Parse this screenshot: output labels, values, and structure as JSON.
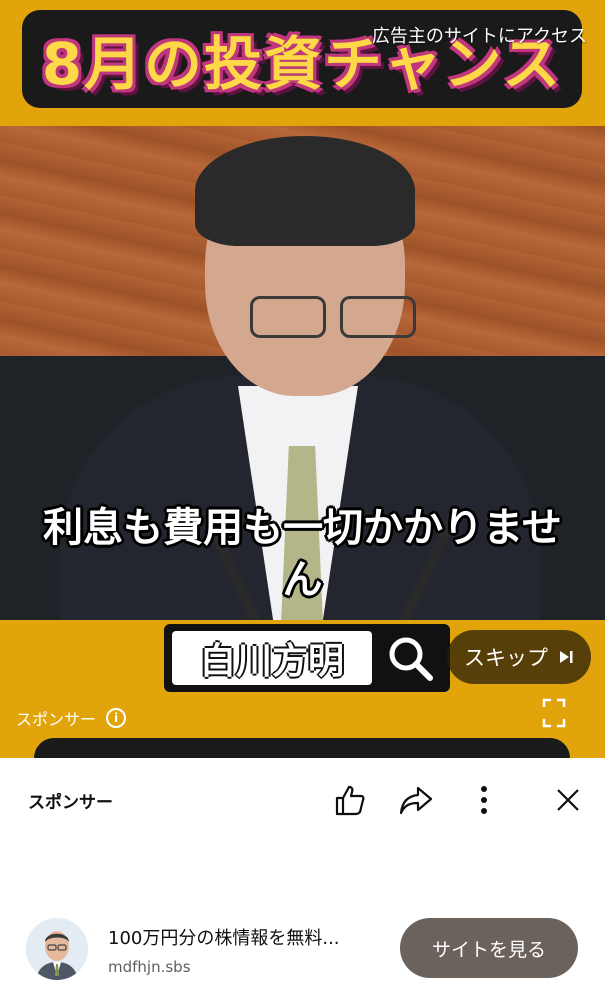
{
  "video": {
    "banner_title": "8月の投資チャンス",
    "advertiser_link": "広告主のサイトにアクセス",
    "caption_line1": "利息も費用も一切かかりませ",
    "caption_line2": "ん",
    "search_query": "白川方明",
    "skip_label": "スキップ",
    "sponsor_label": "スポンサー"
  },
  "panel": {
    "sponsor_label": "スポンサー",
    "ad_title": "100万円分の株情報を無料...",
    "ad_domain": "mdfhjn.sbs",
    "visit_label": "サイトを見る"
  },
  "icons": {
    "like": "thumbs-up-icon",
    "share": "share-icon",
    "more": "more-vertical-icon",
    "close": "close-icon",
    "info": "info-icon",
    "fullscreen": "fullscreen-icon",
    "search": "search-icon",
    "skip": "skip-next-icon"
  },
  "colors": {
    "banner_background": "#e2a40b",
    "banner_text": "#ffd84a",
    "visit_button": "#6b625c"
  }
}
